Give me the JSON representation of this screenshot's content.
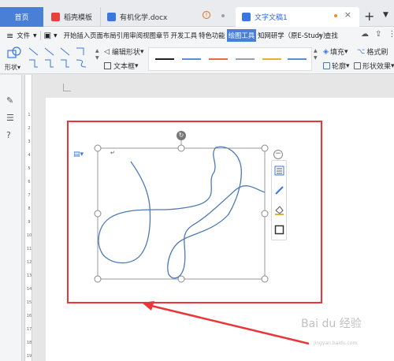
{
  "tabs": {
    "home": "首页",
    "template": "稻壳模板",
    "doc": "有机化学.docx",
    "doc2": "文字文稿1",
    "new_tab": "+",
    "close": "×"
  },
  "menu": {
    "file": "文件",
    "items": [
      "开始",
      "插入",
      "页面布局",
      "引用",
      "审阅",
      "视图",
      "章节",
      "开发工具",
      "特色功能",
      "绘图工具",
      "知网研学（原E-Study）"
    ],
    "active": "绘图工具",
    "search": "查找"
  },
  "toolbar": {
    "shape": "形状",
    "edit_shape": "编辑形状",
    "text_box": "文本框",
    "fill": "填充",
    "format_brush": "格式刷",
    "outline": "轮廓",
    "shape_effect": "形状效果"
  },
  "style_colors": [
    "#222222",
    "#5b8fd8",
    "#e36c4a",
    "#9aa0a6",
    "#e2b13c",
    "#5b8fd8"
  ],
  "accent": "#4a7fd6",
  "highlight_color": "#e8363a",
  "ruler_labels": [
    "1",
    "2",
    "3",
    "4",
    "5",
    "6",
    "7",
    "8",
    "9",
    "10",
    "11",
    "12",
    "13",
    "14",
    "15",
    "16",
    "17",
    "18",
    "19"
  ],
  "watermark": "Bai du 经验",
  "watermark_sub": "jingyan.baidu.com"
}
